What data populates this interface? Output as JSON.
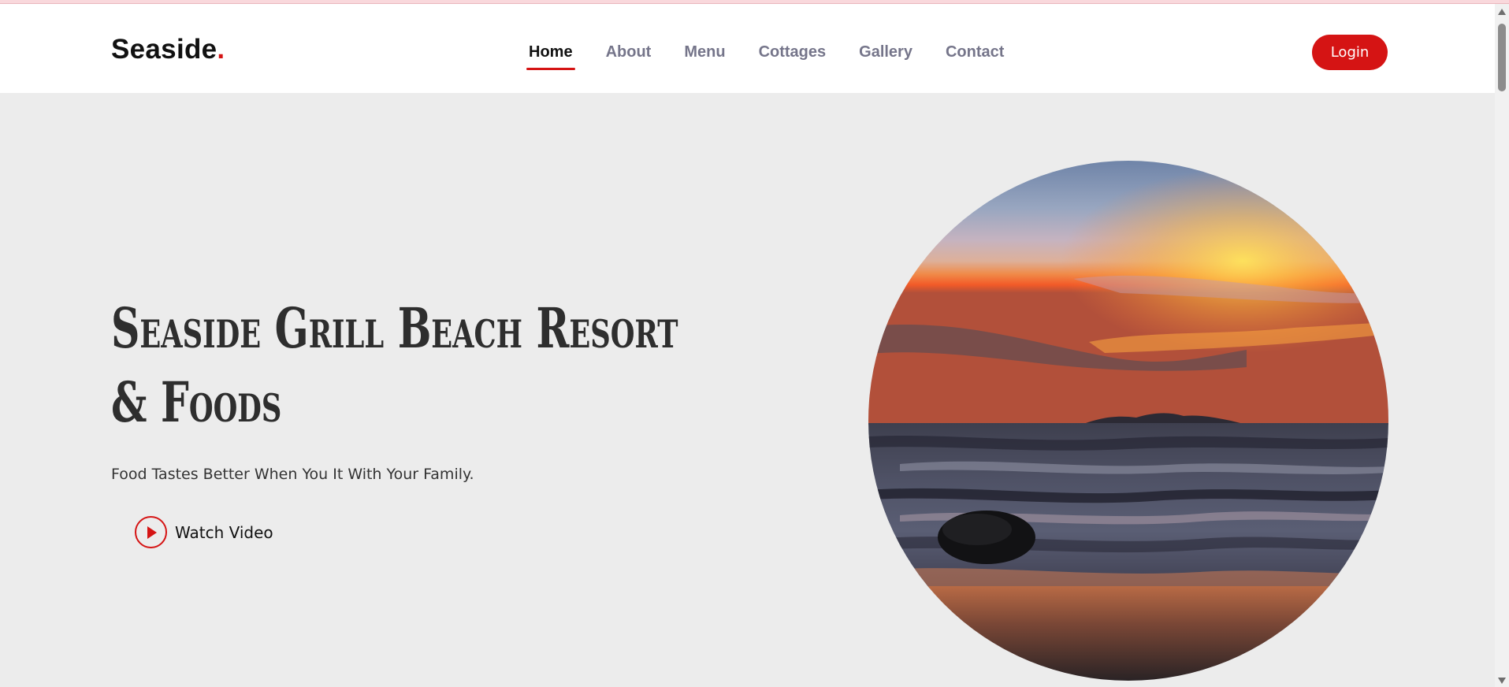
{
  "brand": {
    "name": "Seaside",
    "dot": "."
  },
  "nav": {
    "items": [
      {
        "label": "Home",
        "active": true
      },
      {
        "label": "About",
        "active": false
      },
      {
        "label": "Menu",
        "active": false
      },
      {
        "label": "Cottages",
        "active": false
      },
      {
        "label": "Gallery",
        "active": false
      },
      {
        "label": "Contact",
        "active": false
      }
    ],
    "login_label": "Login"
  },
  "hero": {
    "title_line1": "Seaside Grill Beach Resort",
    "title_line2": "& Foods",
    "subtitle": "Food Tastes Better When You It With Your Family.",
    "watch_label": "Watch Video",
    "image_icon": "sunset-beach-photo"
  },
  "colors": {
    "accent": "#d51414",
    "background": "#ececec",
    "header": "#ffffff",
    "nav_inactive": "#75758a",
    "text_dark": "#111111"
  }
}
